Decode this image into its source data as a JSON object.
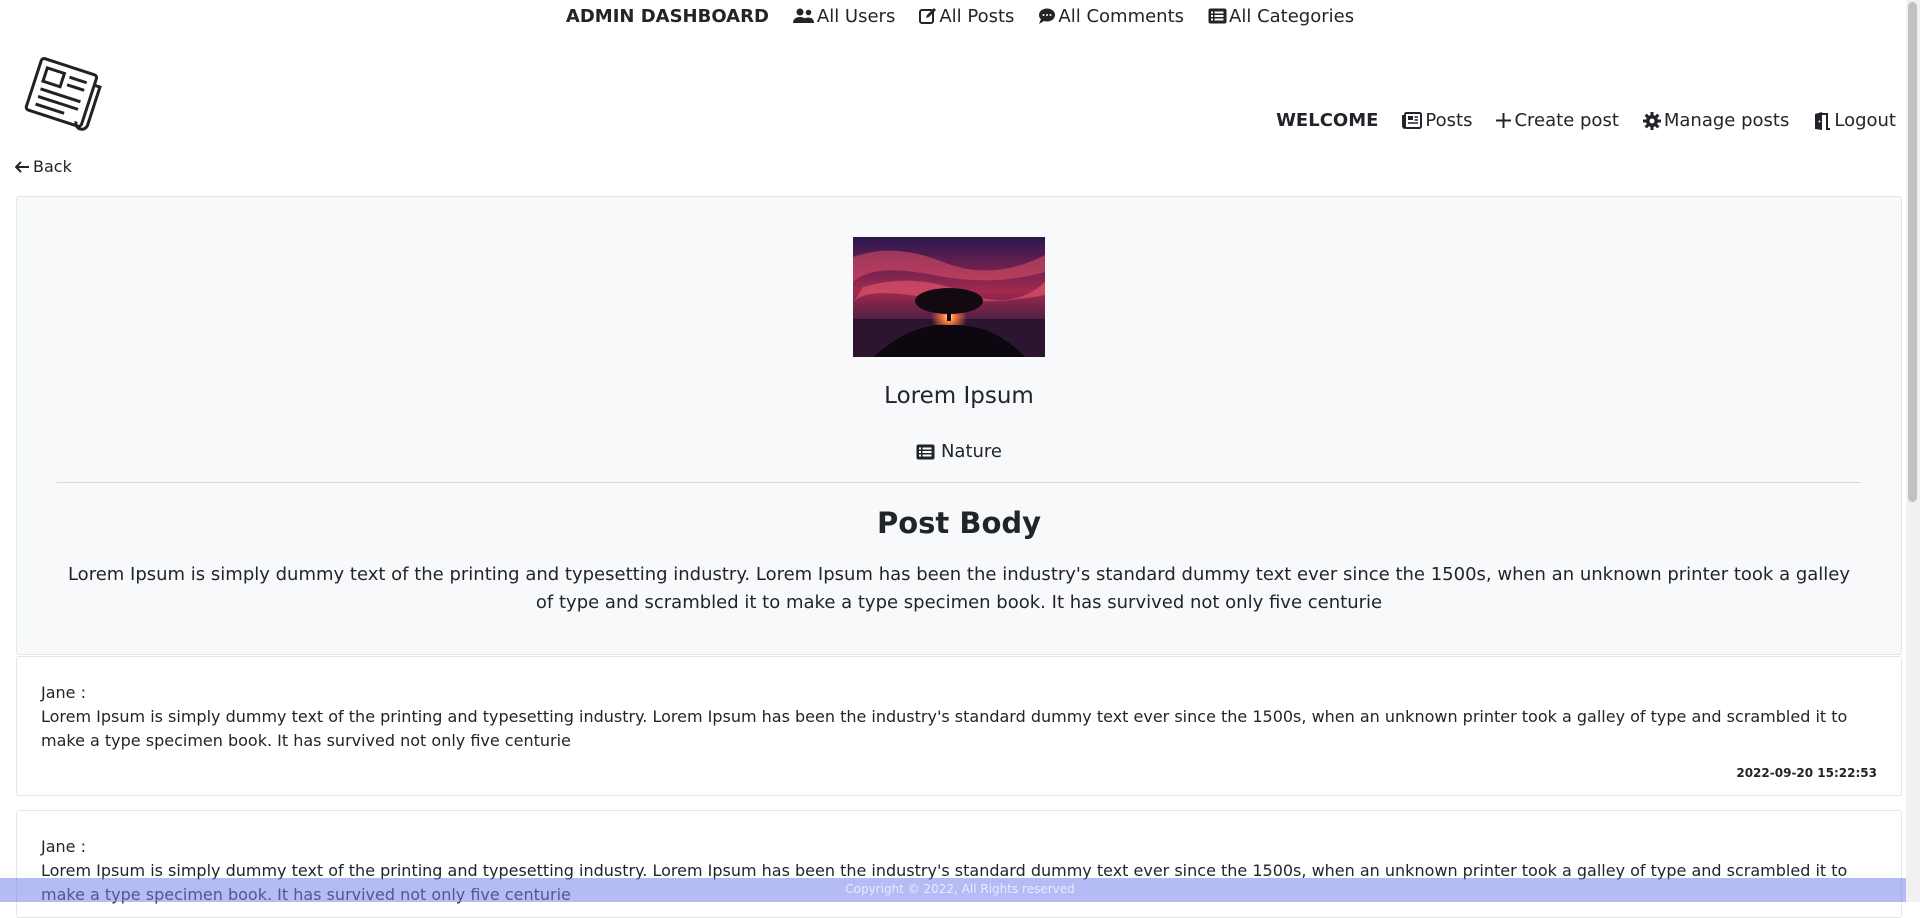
{
  "admin_bar": {
    "title": "ADMIN DASHBOARD",
    "links": [
      {
        "label": "All Users",
        "icon": "users-icon"
      },
      {
        "label": "All Posts",
        "icon": "edit-icon"
      },
      {
        "label": "All Comments",
        "icon": "comments-icon"
      },
      {
        "label": "All Categories",
        "icon": "list-icon"
      }
    ]
  },
  "header": {
    "logo_icon": "newspaper-icon",
    "welcome": "WELCOME",
    "nav": [
      {
        "label": "Posts",
        "icon": "newspaper-icon"
      },
      {
        "label": "Create post",
        "icon": "plus-icon"
      },
      {
        "label": "Manage posts",
        "icon": "gear-icon"
      },
      {
        "label": "Logout",
        "icon": "door-icon"
      }
    ]
  },
  "back_label": "Back",
  "post": {
    "title": "Lorem Ipsum",
    "category": "Nature",
    "body_heading": "Post Body",
    "body": "Lorem Ipsum is simply dummy text of the printing and typesetting industry. Lorem Ipsum has been the industry's standard dummy text ever since the 1500s, when an unknown printer took a galley of type and scrambled it to make a type specimen book. It has survived not only five centurie"
  },
  "comments": [
    {
      "author": "Jane :",
      "text": "Lorem Ipsum is simply dummy text of the printing and typesetting industry. Lorem Ipsum has been the industry's standard dummy text ever since the 1500s, when an unknown printer took a galley of type and scrambled it to make a type specimen book. It has survived not only five centurie",
      "date": "2022-09-20 15:22:53"
    },
    {
      "author": "Jane :",
      "text": "Lorem Ipsum is simply dummy text of the printing and typesetting industry. Lorem Ipsum has been the industry's standard dummy text ever since the 1500s, when an unknown printer took a galley of type and scrambled it to make a type specimen book. It has survived not only five centurie",
      "date": ""
    }
  ],
  "footer": "Copyright © 2022, All Rights reserved",
  "colors": {
    "card_bg": "#f8f9fa",
    "footer_bg": "#7683ec",
    "text": "#212529"
  }
}
